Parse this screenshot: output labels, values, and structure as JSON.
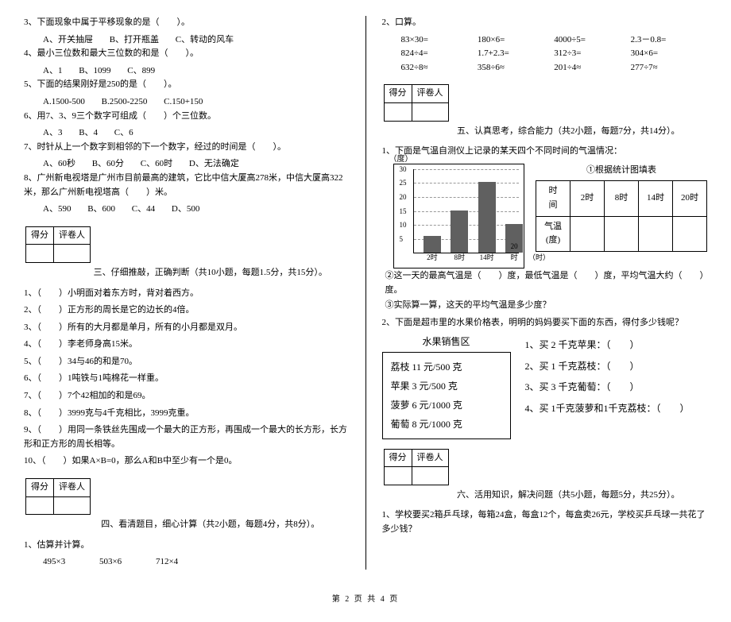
{
  "left": {
    "q3": {
      "text": "3、下面现象中属于平移现象的是（　　）。",
      "opts": [
        "A、开关抽屉",
        "B、打开瓶盖",
        "C、转动的风车"
      ]
    },
    "q4": {
      "text": "4、最小三位数和最大三位数的和是（　　）。",
      "opts": [
        "A、1",
        "B、1099",
        "C、899"
      ]
    },
    "q5": {
      "text": "5、下面的结果刚好是250的是（　　）。",
      "opts": [
        "A.1500-500",
        "B.2500-2250",
        "C.150+150"
      ]
    },
    "q6": {
      "text": "6、用7、3、9三个数字可组成（　　）个三位数。",
      "opts": [
        "A、3",
        "B、4",
        "C、6"
      ]
    },
    "q7": {
      "text": "7、时针从上一个数字到相邻的下一个数字，经过的时间是（　　）。",
      "opts": [
        "A、60秒",
        "B、60分",
        "C、60时",
        "D、无法确定"
      ]
    },
    "q8": {
      "text": "8、广州新电视塔是广州市目前最高的建筑，它比中信大厦高278米，中信大厦高322米，那么广州新电视塔高（　　）米。",
      "opts": [
        "A、590",
        "B、600",
        "C、44",
        "D、500"
      ]
    },
    "score_labels": {
      "score": "得分",
      "grader": "评卷人"
    },
    "sec3_title": "三、仔细推敲，正确判断（共10小题，每题1.5分，共15分）。",
    "sec3_items": [
      "1、（　　）小明面对着东方时，背对着西方。",
      "2、（　　）正方形的周长是它的边长的4倍。",
      "3、（　　）所有的大月都是单月，所有的小月都是双月。",
      "4、（　　）李老师身高15米。",
      "5、（　　）34与46的和是70。",
      "6、（　　）1吨铁与1吨棉花一样重。",
      "7、（　　）7个42相加的和是69。",
      "8、（　　）3999克与4千克相比，3999克重。",
      "9、（　　）用同一条铁丝先围成一个最大的正方形，再围成一个最大的长方形，长方形和正方形的周长相等。",
      "10、（　　）如果A×B=0，那么A和B中至少有一个是0。"
    ],
    "sec4_title": "四、看清题目，细心计算（共2小题，每题4分，共8分）。",
    "sec4_q1": "1、估算并计算。",
    "sec4_items": [
      "495×3",
      "503×6",
      "712×4"
    ]
  },
  "right": {
    "q2": "2、口算。",
    "mental": [
      [
        "83×30=",
        "180×6=",
        "4000÷5=",
        "2.3－0.8="
      ],
      [
        "824÷4=",
        "1.7+2.3=",
        "312÷3=",
        "304×6="
      ],
      [
        "632÷8≈",
        "358÷6≈",
        "201÷4≈",
        "277÷7≈"
      ]
    ],
    "score_labels": {
      "score": "得分",
      "grader": "评卷人"
    },
    "sec5_title": "五、认真思考，综合能力（共2小题，每题7分，共14分）。",
    "sec5_q1": "1、下面是气温自测仪上记录的某天四个不同时间的气温情况：",
    "chart_ylabel": "（度）",
    "fill_title": "①根据统计图填表",
    "fill_table": {
      "h1": "时　间",
      "c1": "2时",
      "c2": "8时",
      "c3": "14时",
      "c4": "20时",
      "h2": "气温(度)"
    },
    "sub_q2": "②这一天的最高气温是（　　）度，最低气温是（　　）度，平均气温大约（　　）度。",
    "sub_q3": "③实际算一算，这天的平均气温是多少度？",
    "sec5_q2": "2、下面是超市里的水果价格表，明明的妈妈要买下面的东西，得付多少钱呢？",
    "fruit_title": "水果销售区",
    "fruit_items": [
      "荔枝 11 元/500 克",
      "苹果 3 元/500 克",
      "菠萝 6 元/1000 克",
      "葡萄 8 元/1000 克"
    ],
    "fruit_q": [
      "1、买 2 千克苹果：（　　）",
      "2、买 1 千克荔枝：（　　）",
      "3、买 3 千克葡萄：（　　）",
      "4、买 1千克菠萝和1千克荔枝：（　　）"
    ],
    "sec6_title": "六、活用知识，解决问题（共5小题，每题5分，共25分）。",
    "sec6_q1": "1、学校要买2箱乒乓球，每箱24盒，每盒12个，每盒卖26元，学校买乒乓球一共花了多少钱？"
  },
  "chart_data": {
    "type": "bar",
    "categories": [
      "2时",
      "8时",
      "14时",
      "20时"
    ],
    "values": [
      6,
      15,
      25,
      10
    ],
    "title": "",
    "xlabel": "（时）",
    "ylabel": "（度）",
    "ylim": [
      0,
      30
    ],
    "yticks": [
      5,
      10,
      15,
      20,
      25,
      30
    ]
  },
  "footer": "第 2 页 共 4 页"
}
